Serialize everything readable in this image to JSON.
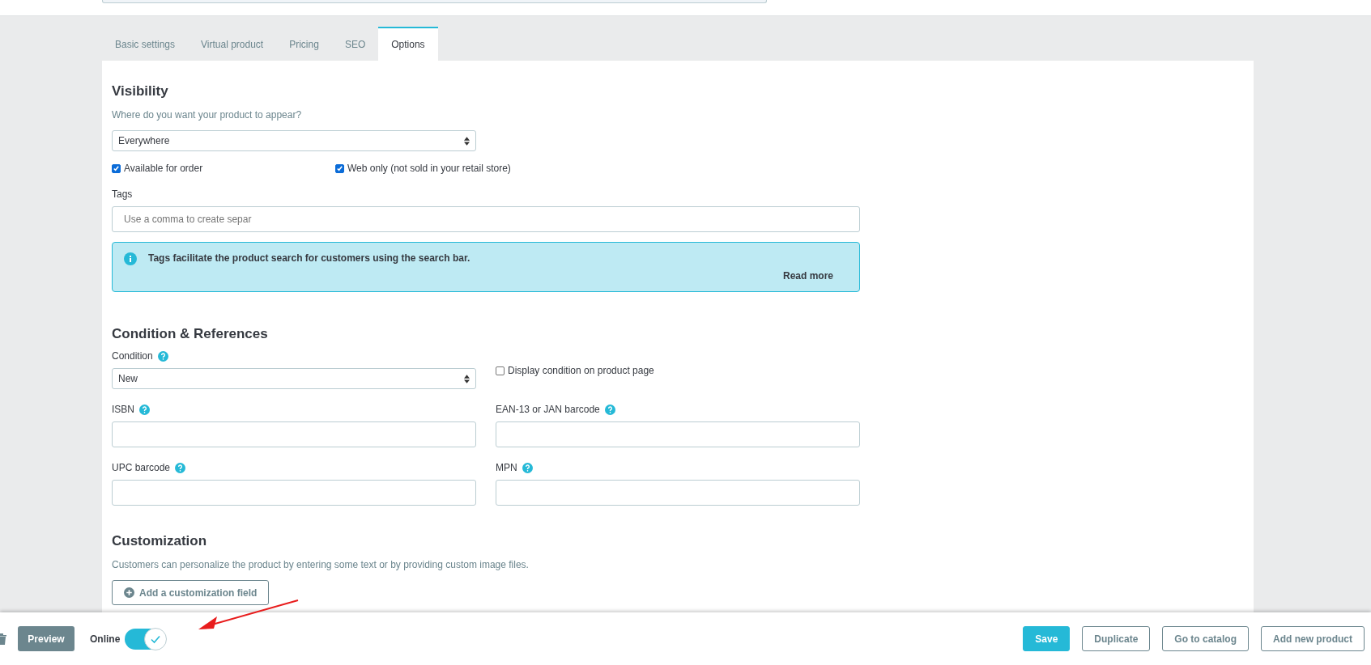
{
  "tabs": [
    {
      "label": "Basic settings",
      "selected": false
    },
    {
      "label": "Virtual product",
      "selected": false
    },
    {
      "label": "Pricing",
      "selected": false
    },
    {
      "label": "SEO",
      "selected": false
    },
    {
      "label": "Options",
      "selected": true
    }
  ],
  "visibility": {
    "title": "Visibility",
    "hint": "Where do you want your product to appear?",
    "select": {
      "value": "Everywhere"
    },
    "checkboxes": [
      {
        "label": "Available for order",
        "checked": true
      },
      {
        "label": "Web only (not sold in your retail store)",
        "checked": true
      }
    ],
    "tags_label": "Tags",
    "tags_field": {
      "placeholder": "Use a comma to create separ"
    },
    "alert": {
      "text": "Tags facilitate the product search for customers using the search bar.",
      "link": "Read more"
    }
  },
  "condition": {
    "title": "Condition & References",
    "condition_label": "Condition",
    "select": {
      "value": "New"
    },
    "display_checkbox": {
      "label": "Display condition on product page",
      "checked": false
    },
    "fields": [
      {
        "label": "ISBN"
      },
      {
        "label": "EAN-13 or JAN barcode"
      },
      {
        "label": "UPC barcode"
      },
      {
        "label": "MPN"
      }
    ]
  },
  "customization": {
    "title": "Customization",
    "hint": "Customers can personalize the product by entering some text or by providing custom image files.",
    "button": "Add a customization field"
  },
  "footer": {
    "preview": "Preview",
    "online_label": "Online",
    "online": true,
    "buttons": [
      {
        "label": "Save",
        "kind": "primary"
      },
      {
        "label": "Duplicate",
        "kind": "outline"
      },
      {
        "label": "Go to catalog",
        "kind": "outline"
      },
      {
        "label": "Add new product",
        "kind": "outline"
      }
    ]
  }
}
